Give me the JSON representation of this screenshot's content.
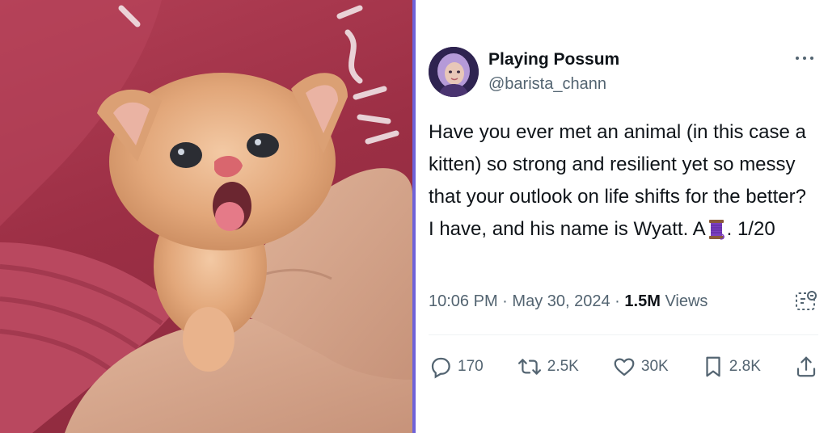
{
  "tweet": {
    "display_name": "Playing Possum",
    "handle": "@barista_chann",
    "text_before": "Have you ever met an animal (in this case a kitten) so strong and resilient yet so messy that your outlook on life shifts for the better? I have, and his name is Wyatt. A",
    "thread_emoji_icon": "spool-of-thread-icon",
    "text_after": ". 1/20",
    "time": "10:06 PM",
    "date": "May 30, 2024",
    "views_count": "1.5M",
    "views_label": "Views",
    "replies": "170",
    "reposts": "2.5K",
    "likes": "30K",
    "bookmarks": "2.8K"
  },
  "colors": {
    "accent_divider": "#6f62d8",
    "text_primary": "#0f1419",
    "text_secondary": "#536471",
    "sweater": "#a8354c"
  }
}
